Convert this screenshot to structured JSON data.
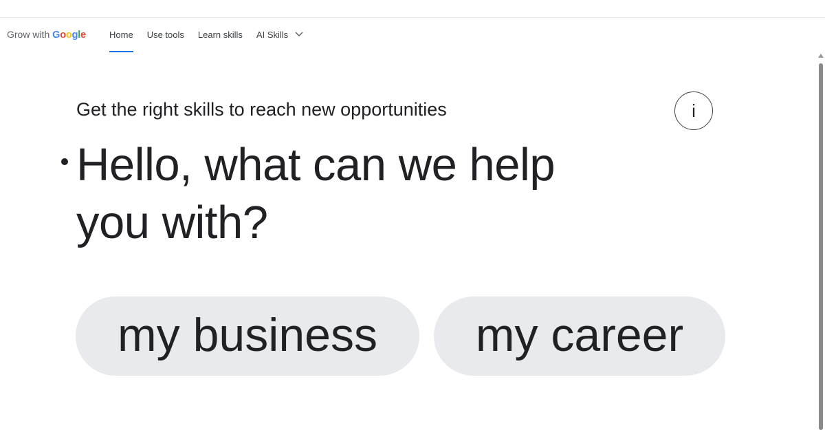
{
  "header": {
    "logo": {
      "prefix": "Grow with ",
      "brand": "Google"
    },
    "nav": [
      {
        "label": "Home",
        "active": true
      },
      {
        "label": "Use tools",
        "active": false
      },
      {
        "label": "Learn skills",
        "active": false
      },
      {
        "label": "AI Skills",
        "active": false,
        "has_dropdown": true
      }
    ],
    "accent_color": "#1a73e8"
  },
  "hero": {
    "subtitle": "Get the right skills to reach new opportunities",
    "headline": "Hello, what can we help you with?",
    "info_button": "i",
    "options": [
      {
        "label": "my business"
      },
      {
        "label": "my career"
      }
    ]
  },
  "colors": {
    "chip_background": "#e8eaed",
    "text": "#202124"
  },
  "icons": {
    "dropdown": "chevron-down-icon",
    "info": "info-icon",
    "bullet": "bullet-dot-icon"
  }
}
